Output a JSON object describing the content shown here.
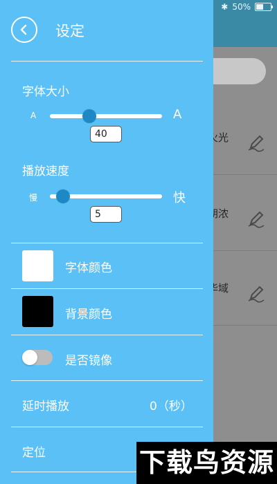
{
  "status_bar": {
    "battery": "50%"
  },
  "background": {
    "items": [
      {
        "text": "火光"
      },
      {
        "text": "胡浓"
      },
      {
        "text": "华域"
      }
    ]
  },
  "drawer": {
    "title": "设定",
    "font_size": {
      "label": "字体大小",
      "min_label": "A",
      "max_label": "A",
      "value": "40",
      "slider_fraction": 0.35
    },
    "speed": {
      "label": "播放速度",
      "min_label": "慢",
      "max_label": "快",
      "value": "5",
      "slider_fraction": 0.12
    },
    "font_color": {
      "label": "字体颜色",
      "color": "#ffffff"
    },
    "bg_color": {
      "label": "背景颜色",
      "color": "#000000"
    },
    "mirror": {
      "label": "是否镜像",
      "on": false
    },
    "delay": {
      "label": "延时播放",
      "value": "0（秒）"
    },
    "position": {
      "label": "定位"
    }
  },
  "colors": {
    "drawer_bg": "#5bc0f5",
    "slider_thumb": "#1e88c7",
    "toolbar": "#3a8aa6"
  },
  "watermark": {
    "text": "下载鸟资源"
  }
}
